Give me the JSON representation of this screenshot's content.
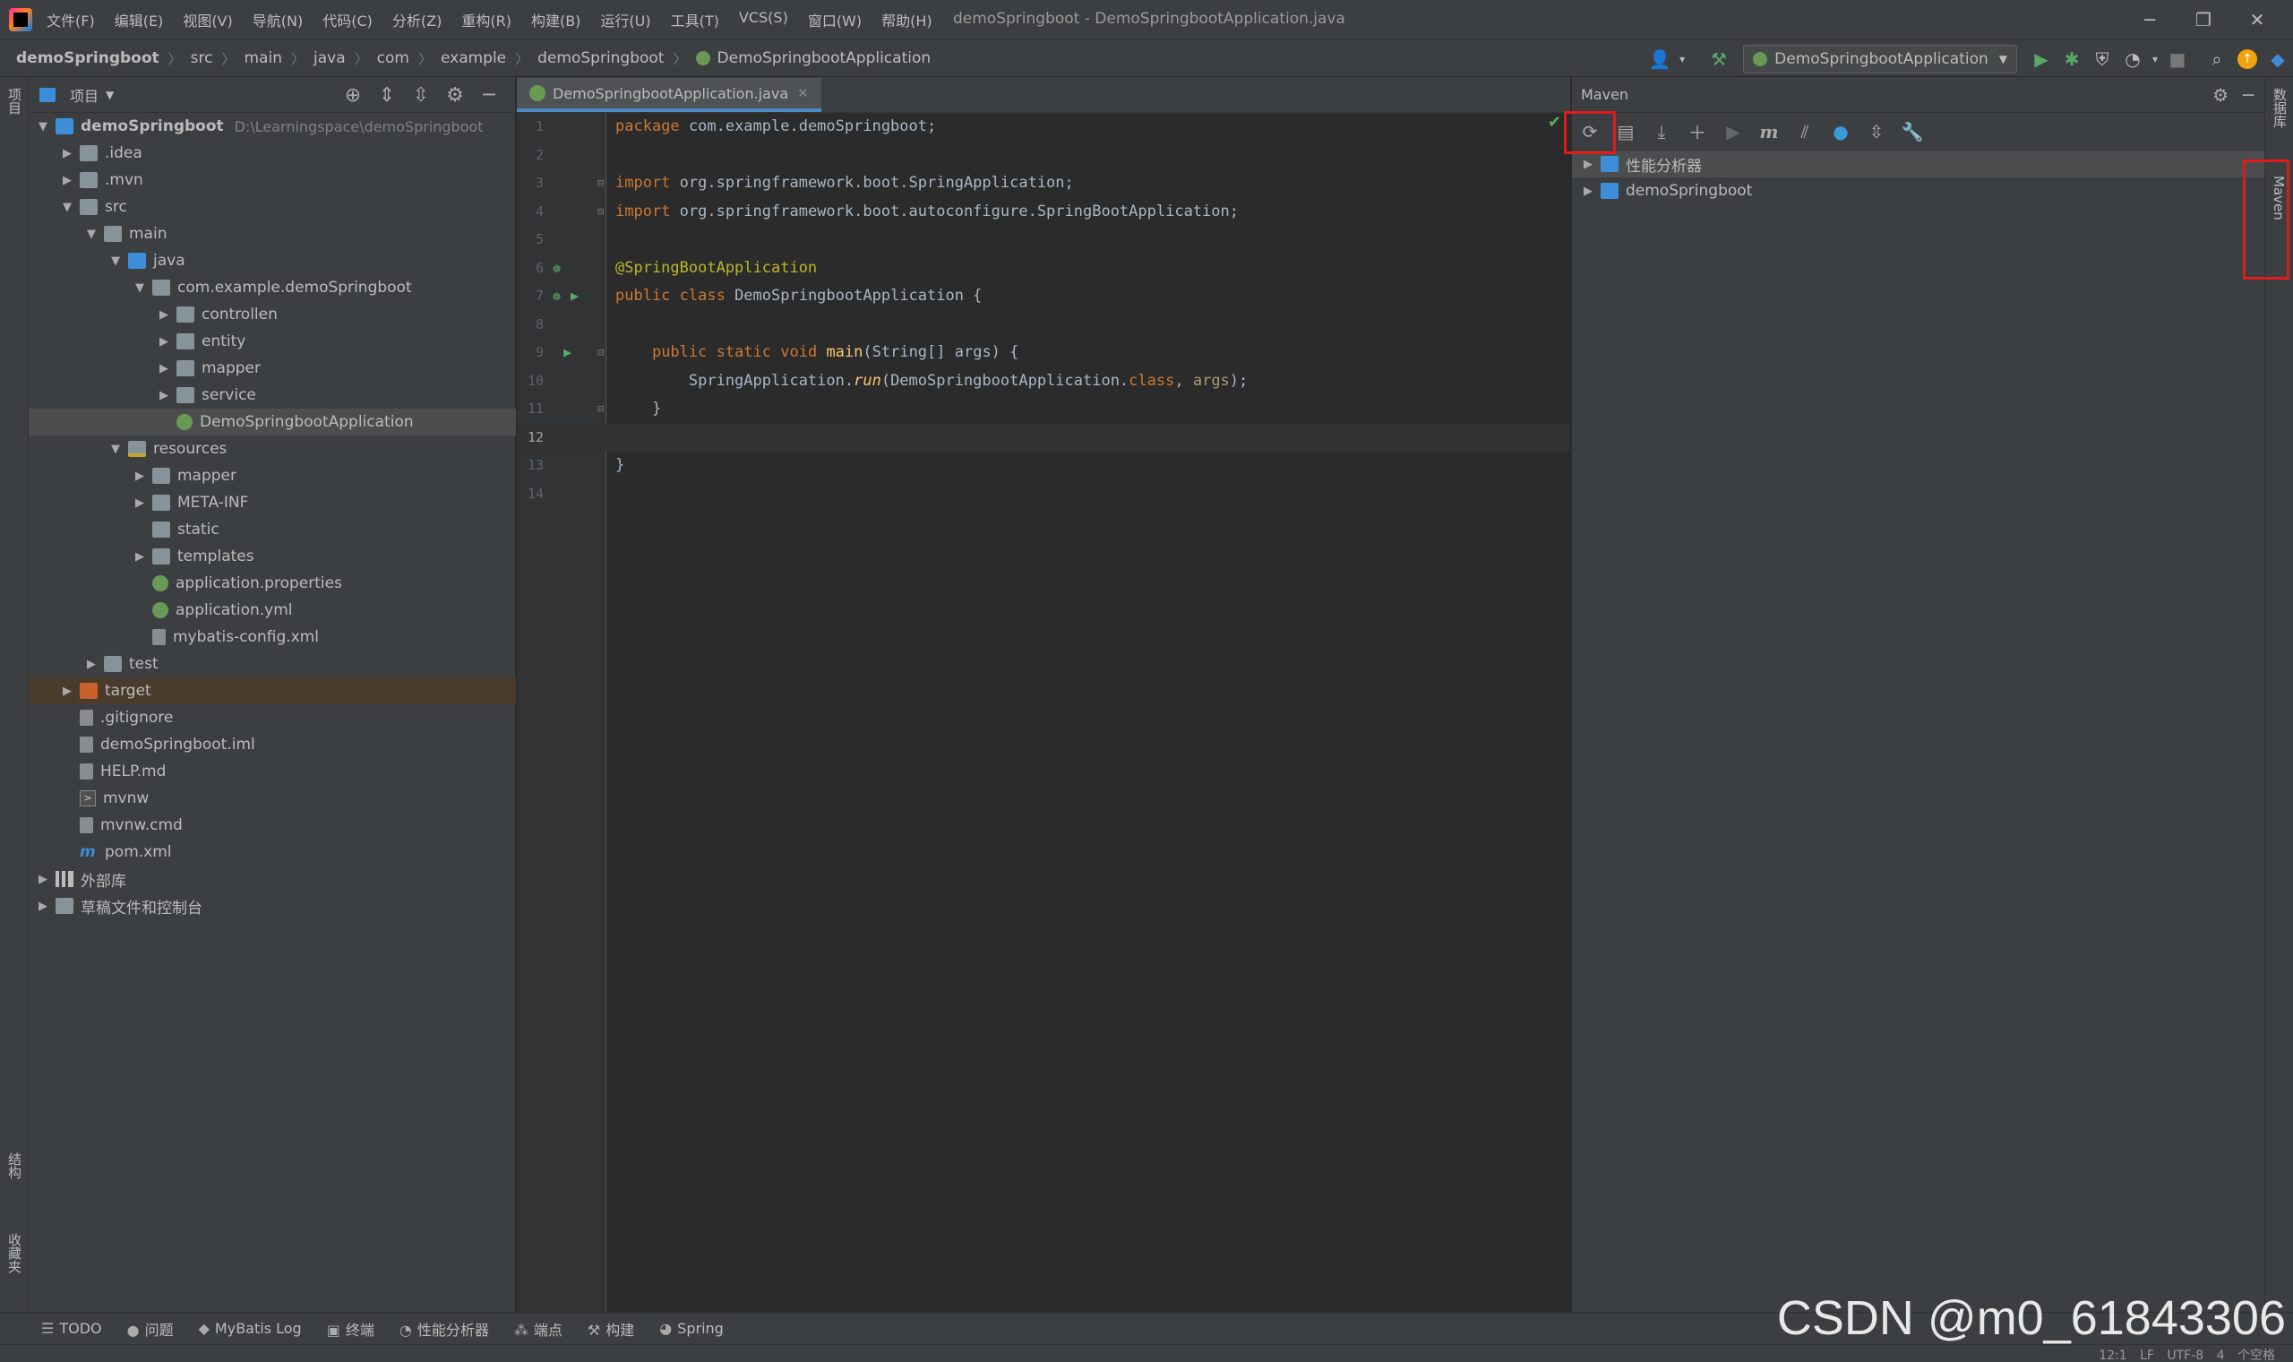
{
  "menu": {
    "items": [
      "文件(F)",
      "编辑(E)",
      "视图(V)",
      "导航(N)",
      "代码(C)",
      "分析(Z)",
      "重构(R)",
      "构建(B)",
      "运行(U)",
      "工具(T)",
      "VCS(S)",
      "窗口(W)",
      "帮助(H)"
    ],
    "window_title": "demoSpringboot - DemoSpringbootApplication.java"
  },
  "breadcrumbs": [
    "demoSpringboot",
    "src",
    "main",
    "java",
    "com",
    "example",
    "demoSpringboot",
    "DemoSpringbootApplication"
  ],
  "run_config": "DemoSpringbootApplication",
  "left_stripe": {
    "project": "项目",
    "structure": "结构",
    "favorites": "收藏夹"
  },
  "right_stripe": {
    "database": "数据库",
    "maven": "Maven"
  },
  "project_panel": {
    "title": "项目",
    "tree": [
      {
        "label": "demoSpringboot",
        "hint": "D:\\Learningspace\\demoSpringboot",
        "level": 0,
        "arrow": "open",
        "icon": "module",
        "bold": true
      },
      {
        "label": ".idea",
        "level": 1,
        "arrow": "closed",
        "icon": "folder"
      },
      {
        "label": ".mvn",
        "level": 1,
        "arrow": "closed",
        "icon": "folder"
      },
      {
        "label": "src",
        "level": 1,
        "arrow": "open",
        "icon": "folder"
      },
      {
        "label": "main",
        "level": 2,
        "arrow": "open",
        "icon": "folder"
      },
      {
        "label": "java",
        "level": 3,
        "arrow": "open",
        "icon": "folder-blue"
      },
      {
        "label": "com.example.demoSpringboot",
        "level": 4,
        "arrow": "open",
        "icon": "folder"
      },
      {
        "label": "controllen",
        "level": 5,
        "arrow": "closed",
        "icon": "folder"
      },
      {
        "label": "entity",
        "level": 5,
        "arrow": "closed",
        "icon": "folder"
      },
      {
        "label": "mapper",
        "level": 5,
        "arrow": "closed",
        "icon": "folder"
      },
      {
        "label": "service",
        "level": 5,
        "arrow": "closed",
        "icon": "folder"
      },
      {
        "label": "DemoSpringbootApplication",
        "level": 5,
        "arrow": "none",
        "icon": "spring",
        "selected": true
      },
      {
        "label": "resources",
        "level": 3,
        "arrow": "open",
        "icon": "folder-res"
      },
      {
        "label": "mapper",
        "level": 4,
        "arrow": "closed",
        "icon": "folder"
      },
      {
        "label": "META-INF",
        "level": 4,
        "arrow": "closed",
        "icon": "folder"
      },
      {
        "label": "static",
        "level": 4,
        "arrow": "none",
        "icon": "folder"
      },
      {
        "label": "templates",
        "level": 4,
        "arrow": "closed",
        "icon": "folder"
      },
      {
        "label": "application.properties",
        "level": 4,
        "arrow": "none",
        "icon": "spring"
      },
      {
        "label": "application.yml",
        "level": 4,
        "arrow": "none",
        "icon": "spring"
      },
      {
        "label": "mybatis-config.xml",
        "level": 4,
        "arrow": "none",
        "icon": "file"
      },
      {
        "label": "test",
        "level": 2,
        "arrow": "closed",
        "icon": "folder"
      },
      {
        "label": "target",
        "level": 1,
        "arrow": "closed",
        "icon": "folder-orange",
        "excluded": true
      },
      {
        "label": ".gitignore",
        "level": 1,
        "arrow": "none",
        "icon": "file"
      },
      {
        "label": "demoSpringboot.iml",
        "level": 1,
        "arrow": "none",
        "icon": "file"
      },
      {
        "label": "HELP.md",
        "level": 1,
        "arrow": "none",
        "icon": "file"
      },
      {
        "label": "mvnw",
        "level": 1,
        "arrow": "none",
        "icon": "mvnw"
      },
      {
        "label": "mvnw.cmd",
        "level": 1,
        "arrow": "none",
        "icon": "file"
      },
      {
        "label": "pom.xml",
        "level": 1,
        "arrow": "none",
        "icon": "xml-m"
      },
      {
        "label": "外部库",
        "level": 0,
        "arrow": "closed",
        "icon": "lib"
      },
      {
        "label": "草稿文件和控制台",
        "level": 0,
        "arrow": "closed",
        "icon": "scratch"
      }
    ]
  },
  "editor": {
    "tab_label": "DemoSpringbootApplication.java",
    "lines": [
      {
        "n": "1",
        "html": "<span class='kw'>package</span> com.example.demoSpringboot;"
      },
      {
        "n": "2",
        "html": ""
      },
      {
        "n": "3",
        "html": "<span class='kw'>import</span> org.springframework.boot.SpringApplication;"
      },
      {
        "n": "4",
        "html": "<span class='kw'>import</span> org.springframework.boot.autoconfigure.SpringBootApplication;"
      },
      {
        "n": "5",
        "html": ""
      },
      {
        "n": "6",
        "html": "<span class='ann'>@SpringBootApplication</span>"
      },
      {
        "n": "7",
        "html": "<span class='kw'>public class</span> DemoSpringbootApplication {"
      },
      {
        "n": "8",
        "html": ""
      },
      {
        "n": "9",
        "html": "    <span class='kw'>public static void</span> <span class='method'>main</span>(String[] args) {"
      },
      {
        "n": "10",
        "html": "        SpringApplication.<span class='static-call'>run</span>(DemoSpringbootApplication.<span class='kw'>class</span>, <span class='param'>args</span>);"
      },
      {
        "n": "11",
        "html": "    }"
      },
      {
        "n": "12",
        "html": ""
      },
      {
        "n": "13",
        "html": "}"
      },
      {
        "n": "14",
        "html": ""
      }
    ],
    "current_line": "12"
  },
  "maven_panel": {
    "title": "Maven",
    "tree": [
      {
        "label": "性能分析器",
        "selected": true
      },
      {
        "label": "demoSpringboot"
      }
    ]
  },
  "bottom_tools": [
    {
      "icon": "☰",
      "label": "TODO",
      "name": "todo"
    },
    {
      "icon": "●",
      "label": "问题",
      "name": "problems"
    },
    {
      "icon": "◆",
      "label": "MyBatis Log",
      "name": "mybatis-log"
    },
    {
      "icon": "▣",
      "label": "终端",
      "name": "terminal"
    },
    {
      "icon": "◔",
      "label": "性能分析器",
      "name": "profiler"
    },
    {
      "icon": "⁂",
      "label": "端点",
      "name": "endpoints"
    },
    {
      "icon": "⚒",
      "label": "构建",
      "name": "build"
    },
    {
      "icon": "◕",
      "label": "Spring",
      "name": "spring"
    }
  ],
  "status": {
    "text": "12:1  LF  UTF-8  4 个空格"
  },
  "watermark": "CSDN @m0_61843306",
  "colors": {
    "highlight_box": "#e01b1b",
    "accent_tab": "#4a88c7",
    "run_green": "#59a869"
  }
}
